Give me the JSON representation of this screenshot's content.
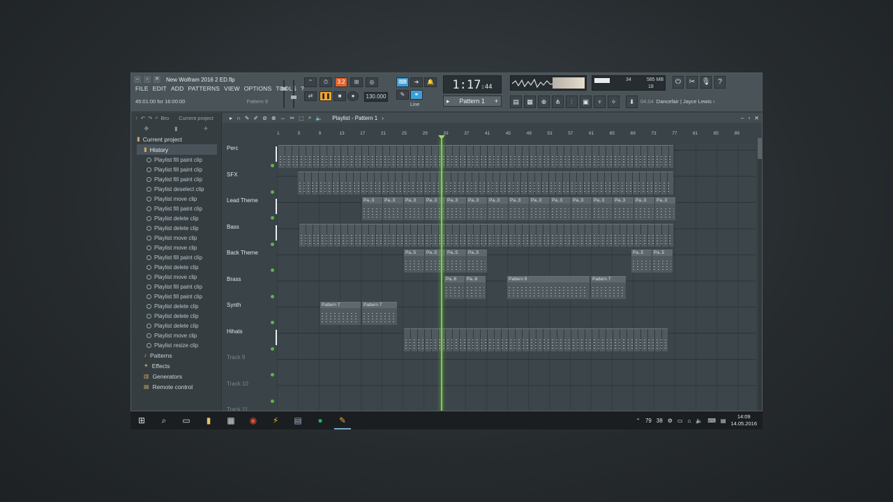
{
  "window": {
    "title": "New Wolfram 2016 2 ED.flp",
    "menu": [
      "FILE",
      "EDIT",
      "ADD",
      "PATTERNS",
      "VIEW",
      "OPTIONS",
      "TOOLS",
      "?"
    ],
    "hint_left": "45:01:00 for 16:00:00",
    "hint_right": "Pattern 9"
  },
  "transport": {
    "time": "1:17",
    "time_small": ":44",
    "time_label": "M:S:CS",
    "tempo": "130.000",
    "pattern_selector": "Pattern 1",
    "snap": "Line",
    "rec_label": "3.2"
  },
  "meters": {
    "cpu_val": "34",
    "mem": "585 MB",
    "poly": "18"
  },
  "news": {
    "code": "04.04",
    "text": "Dancefair | Jayce Lewis"
  },
  "browser": {
    "head": [
      "Bro",
      "Current project"
    ],
    "project": "Current project",
    "history_label": "History",
    "history": [
      "Playlist fill paint clip",
      "Playlist fill paint clip",
      "Playlist fill paint clip",
      "Playlist deselect clip",
      "Playlist move clip",
      "Playlist fill paint clip",
      "Playlist delete clip",
      "Playlist delete clip",
      "Playlist move clip",
      "Playlist move clip",
      "Playlist fill paint clip",
      "Playlist delete clip",
      "Playlist move clip",
      "Playlist fill paint clip",
      "Playlist fill paint clip",
      "Playlist delete clip",
      "Playlist delete clip",
      "Playlist delete clip",
      "Playlist move clip",
      "Playlist resize clip"
    ],
    "folders": [
      "Patterns",
      "Effects",
      "Generators",
      "Remote control"
    ]
  },
  "playlist": {
    "title": "Playlist - Pattern 1",
    "ruler": [
      "1",
      "5",
      "9",
      "13",
      "17",
      "21",
      "25",
      "29",
      "33",
      "37",
      "41",
      "45",
      "49",
      "53",
      "57",
      "61",
      "65",
      "69",
      "73",
      "77",
      "81",
      "85",
      "89"
    ],
    "tracks": [
      {
        "name": "Perc",
        "active": true
      },
      {
        "name": "SFX",
        "active": true
      },
      {
        "name": "Lead Theme",
        "active": true
      },
      {
        "name": "Bass",
        "active": true
      },
      {
        "name": "Back Theme",
        "active": true
      },
      {
        "name": "Brass",
        "active": true
      },
      {
        "name": "Synth",
        "active": true
      },
      {
        "name": "Hihats",
        "active": true
      },
      {
        "name": "Track 9",
        "active": false
      },
      {
        "name": "Track 10",
        "active": false
      },
      {
        "name": "Track 11",
        "active": false
      }
    ],
    "clip_labels": {
      "pattern7": "Pattern 7",
      "pattern9": "Pattern 9",
      "pa3": "Pa..3",
      "pa5": "Pa..5",
      "pa6": "Pa..6"
    }
  },
  "taskbar": {
    "tray_nums": [
      "79",
      "38"
    ],
    "time": "14:09",
    "date": "14.05.2016"
  }
}
